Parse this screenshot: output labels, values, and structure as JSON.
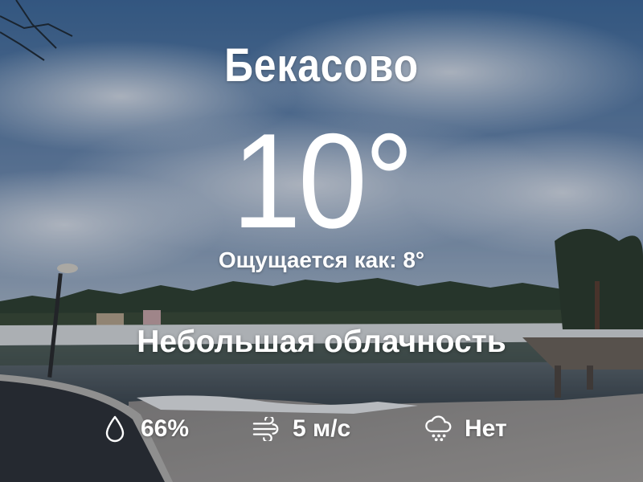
{
  "location": {
    "city": "Бекасово"
  },
  "current": {
    "temperature": "10°",
    "feels_like": "Ощущается как: 8°",
    "condition": "Небольшая облачность"
  },
  "details": {
    "humidity": {
      "value": "66%",
      "icon": "droplet-icon"
    },
    "wind": {
      "value": "5 м/с",
      "icon": "wind-icon"
    },
    "precipitation": {
      "value": "Нет",
      "icon": "cloud-snow-icon"
    }
  },
  "theme": {
    "text_color": "#ffffff",
    "sky_color": "#3f6a9a",
    "water_color": "#4a5760"
  }
}
